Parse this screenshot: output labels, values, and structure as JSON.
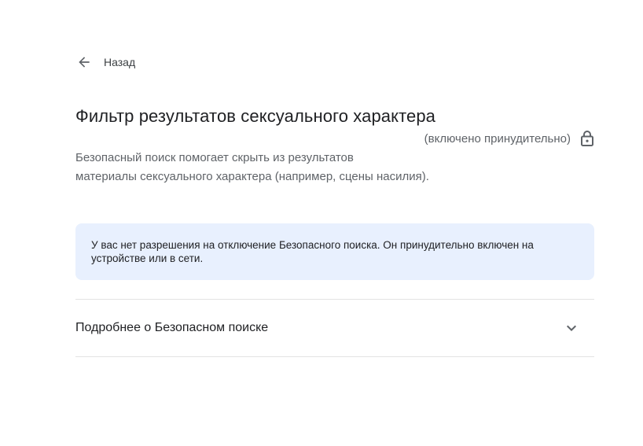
{
  "nav": {
    "back_label": "Назад",
    "back_icon": "arrow-back-icon"
  },
  "section": {
    "title": "Фильтр результатов сексуального характера",
    "status": "(включено принудительно)",
    "status_icon": "lock-icon",
    "description_line1": "Безопасный поиск помогает скрыть из результатов",
    "description_line2": "материалы сексуального характера (например, сцены насилия)."
  },
  "notice": {
    "text": "У вас нет разрешения на отключение Безопасного поиска. Он принудительно включен на устройстве или в сети.",
    "background": "#e8f0fe"
  },
  "expander": {
    "label": "Подробнее о Безопасном поиске",
    "icon": "chevron-down-icon"
  }
}
